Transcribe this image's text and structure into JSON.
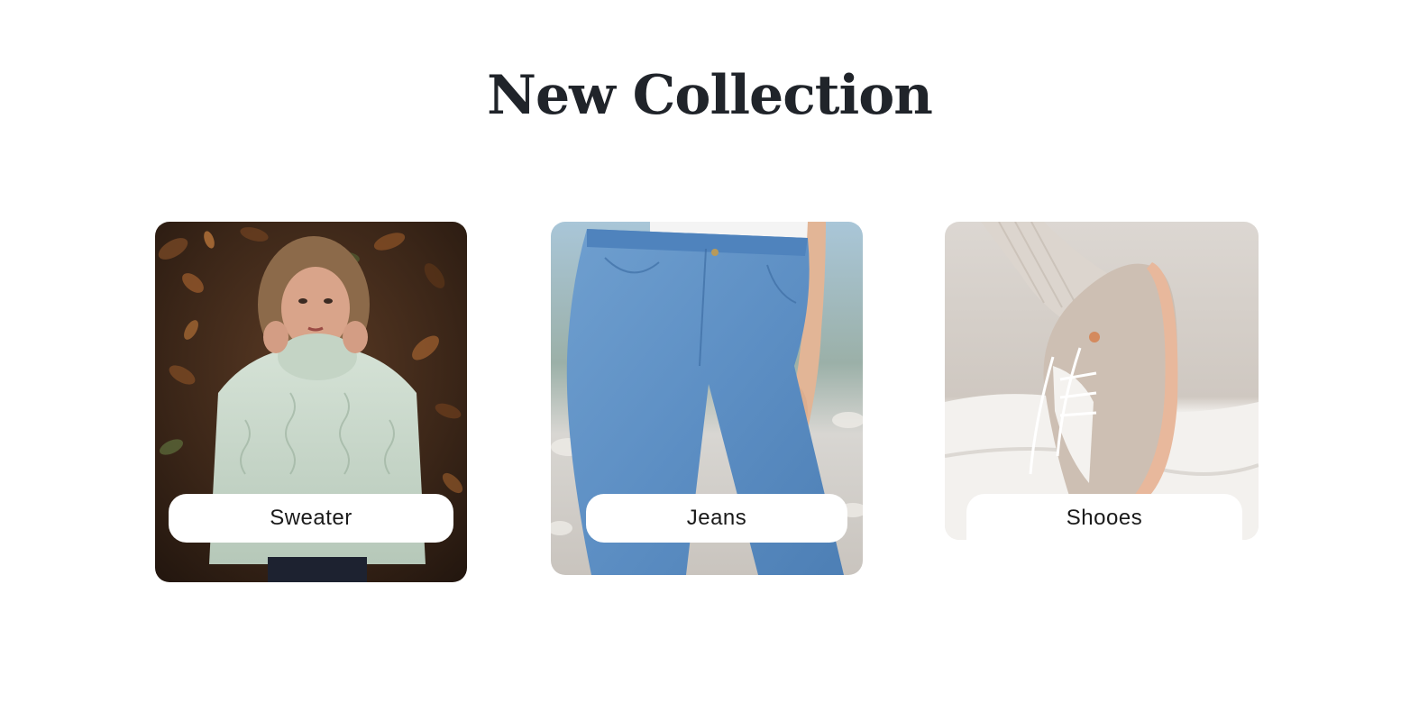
{
  "section": {
    "title": "New Collection"
  },
  "cards": [
    {
      "label": "Sweater",
      "image": "woman-in-knit-sweater-on-autumn-leaves"
    },
    {
      "label": "Jeans",
      "image": "woman-wearing-light-blue-jeans"
    },
    {
      "label": "Shooes",
      "image": "beige-sneaker-on-white-fabric"
    }
  ],
  "colors": {
    "title": "#20242a",
    "label_background": "#ffffff",
    "label_text": "#1a1a1a"
  }
}
